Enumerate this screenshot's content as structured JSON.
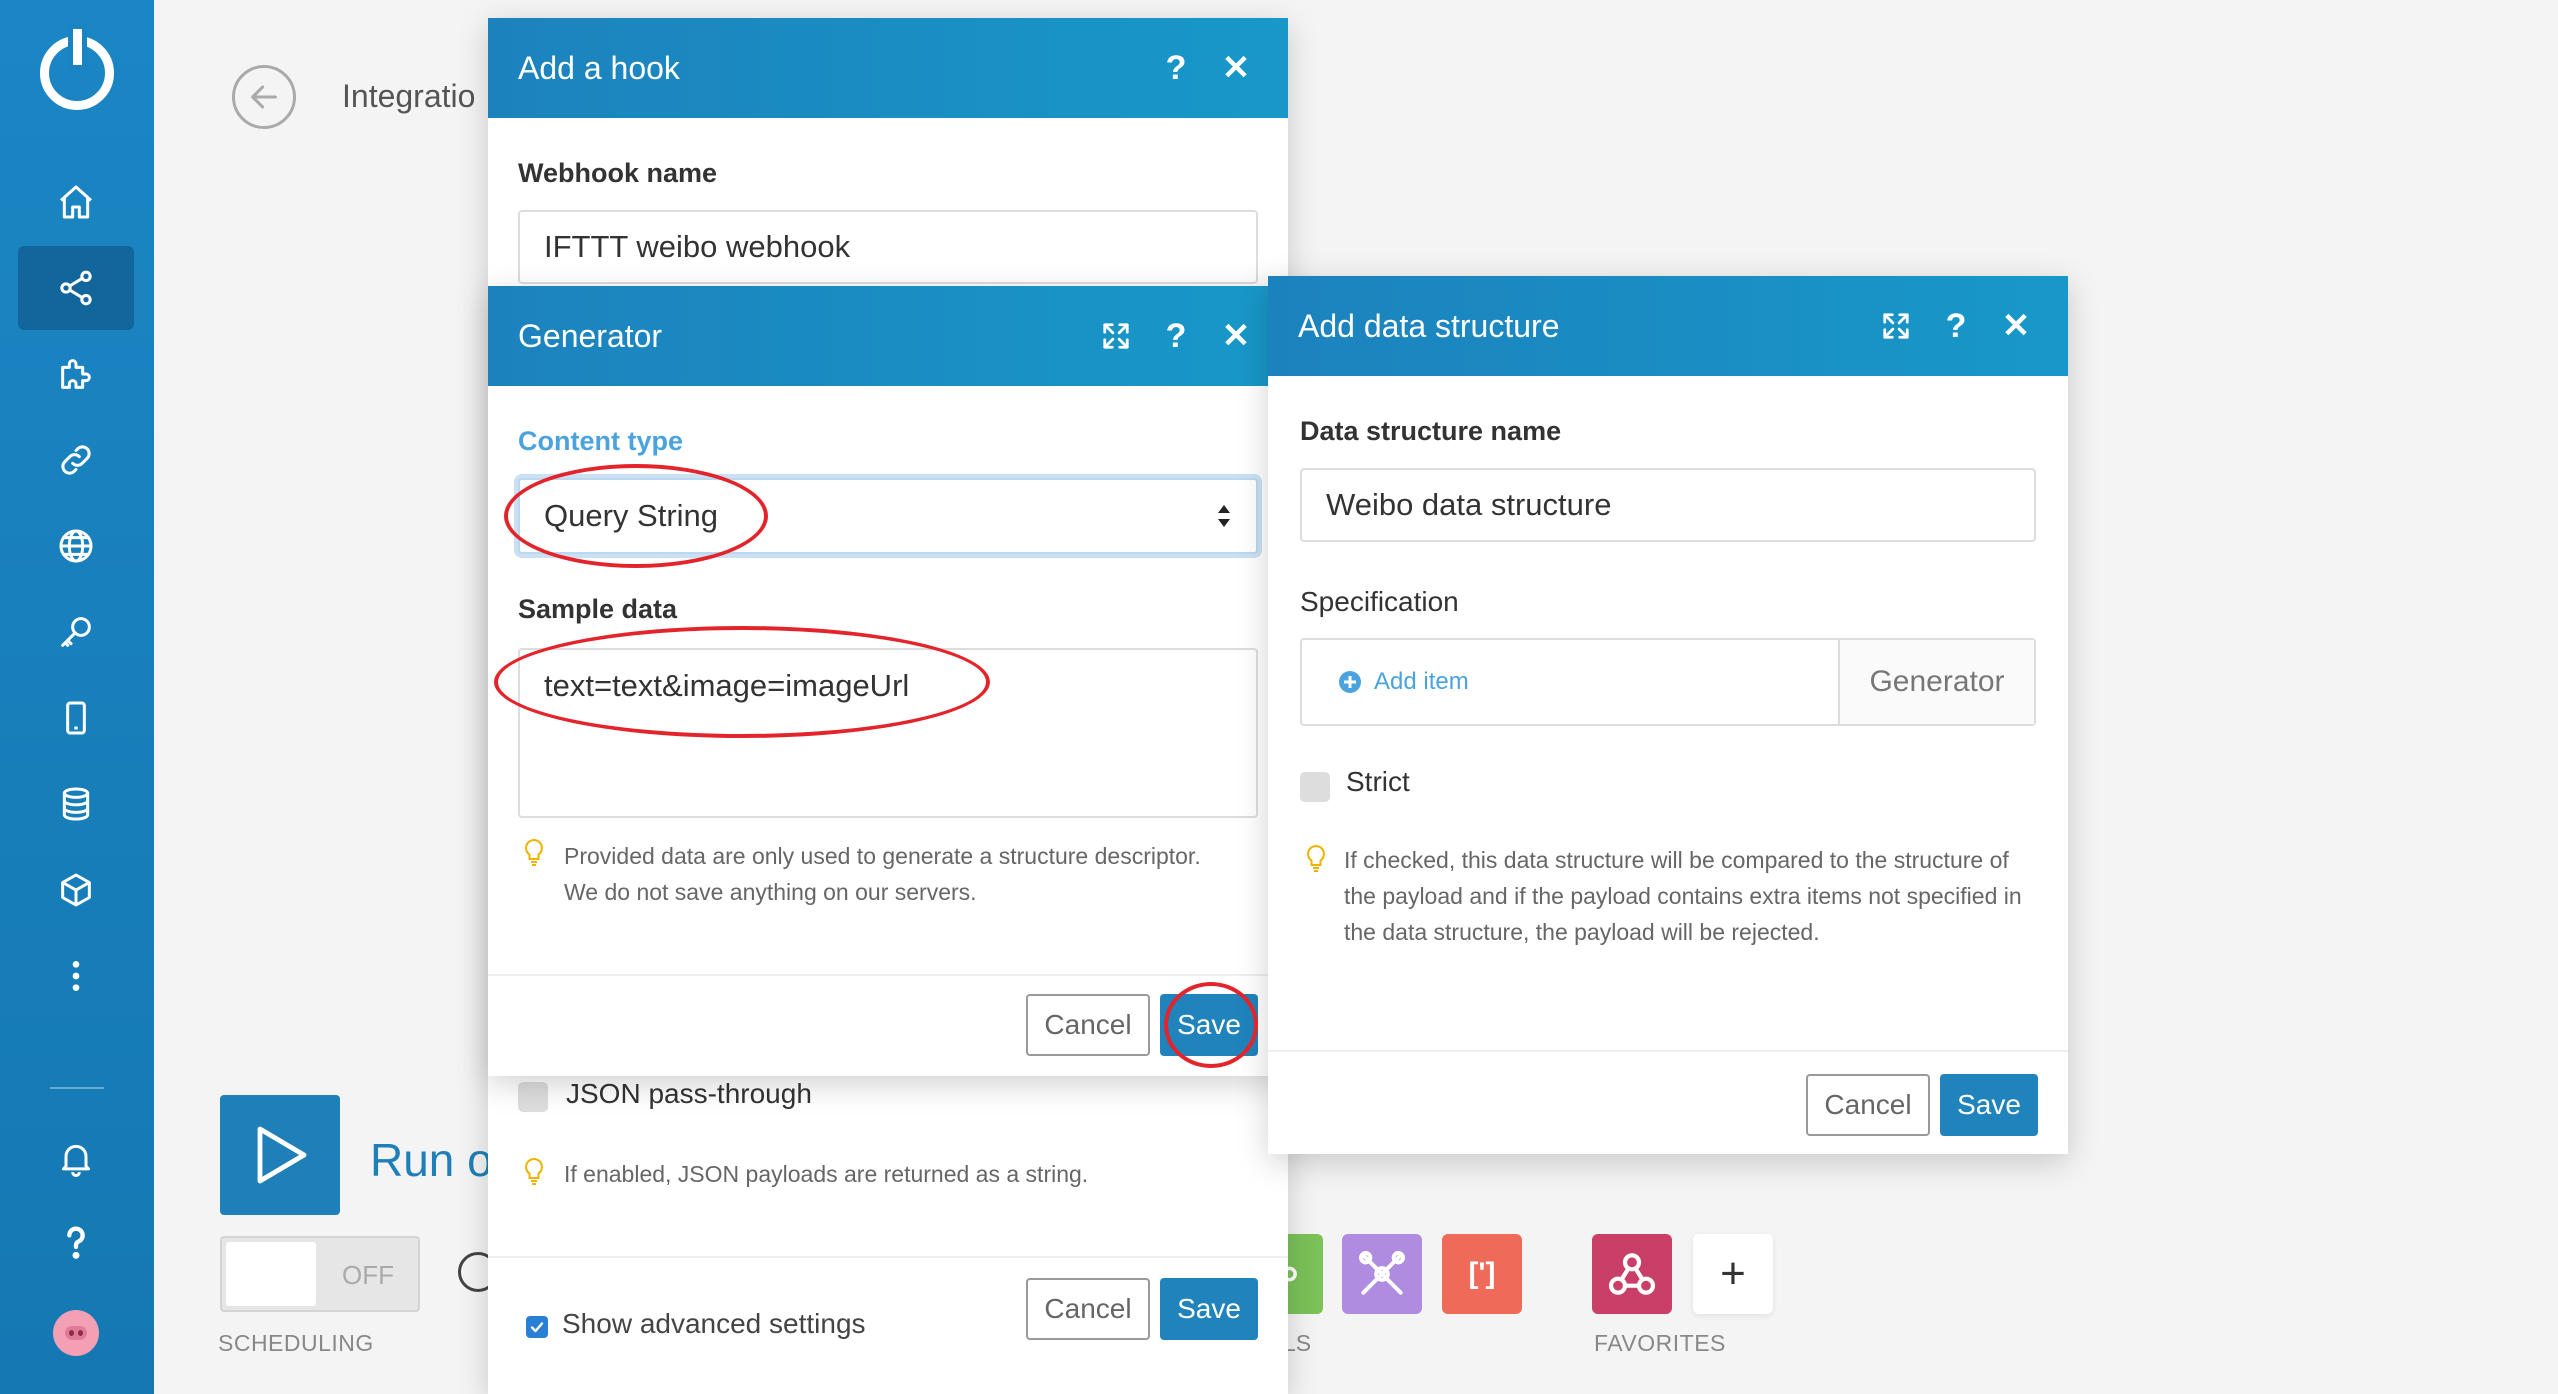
{
  "background": {
    "page_title": "Integratio",
    "run_label": "Run o",
    "toggle_label": "OFF",
    "scheduling_label": "SCHEDULING",
    "tools_label": "LS",
    "favorites_label": "FAVORITES",
    "plus_label": "+",
    "red_tool_label": "[']"
  },
  "hook_modal": {
    "title": "Add a hook",
    "webhook_name_label": "Webhook name",
    "webhook_name_value": "IFTTT weibo webhook",
    "json_passthrough_label": "JSON pass-through",
    "json_hint": "If enabled, JSON payloads are returned as a string.",
    "show_advanced_label": "Show advanced settings",
    "cancel_label": "Cancel",
    "save_label": "Save"
  },
  "generator_modal": {
    "title": "Generator",
    "content_type_label": "Content type",
    "content_type_value": "Query String",
    "sample_data_label": "Sample data",
    "sample_data_value": "text=text&image=imageUrl",
    "hint": "Provided data are only used to generate a structure descriptor. We do not save anything on our servers.",
    "cancel_label": "Cancel",
    "save_label": "Save"
  },
  "data_structure_modal": {
    "title": "Add data structure",
    "name_label": "Data structure name",
    "name_value": "Weibo data structure",
    "specification_label": "Specification",
    "add_item_label": "Add item",
    "generator_label": "Generator",
    "strict_label": "Strict",
    "hint": "If checked, this data structure will be compared to the structure of the payload and if the payload contains extra items not specified in the data structure, the payload will be rejected.",
    "cancel_label": "Cancel",
    "save_label": "Save"
  },
  "icons": {
    "help": "?",
    "close": "✕"
  },
  "colors": {
    "sidebar": "#1b86c4",
    "header": "#1c82bd",
    "accent": "#2083bb",
    "annotation": "#e3242b"
  }
}
